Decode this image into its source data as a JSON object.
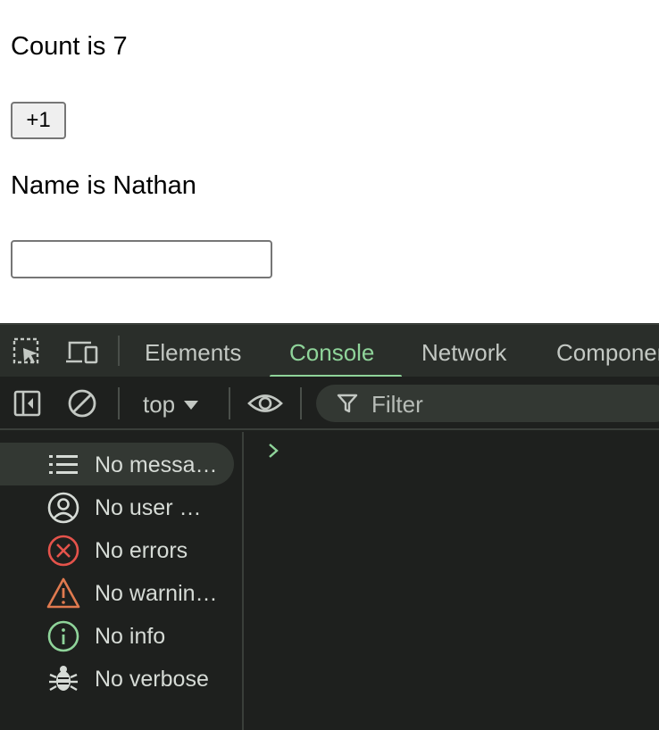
{
  "app": {
    "count_text": "Count is 7",
    "increment_label": "+1",
    "name_text": "Name is Nathan",
    "name_input_value": "",
    "name_input_placeholder": ""
  },
  "devtools": {
    "tabs": [
      {
        "label": "Elements",
        "active": false
      },
      {
        "label": "Console",
        "active": true
      },
      {
        "label": "Network",
        "active": false
      },
      {
        "label": "Components",
        "active": false
      }
    ],
    "icons": {
      "inspect": "inspect-element-icon",
      "device": "device-toolbar-icon",
      "sidebar_toggle": "sidebar-toggle-icon",
      "clear": "clear-console-icon",
      "eye": "live-expression-icon",
      "filter": "filter-icon",
      "prompt": "console-prompt-icon"
    },
    "context_select": "top",
    "filter_placeholder": "Filter",
    "sidebar_items": [
      {
        "label": "No messa…",
        "icon": "list-icon",
        "selected": true
      },
      {
        "label": "No user …",
        "icon": "user-icon",
        "selected": false
      },
      {
        "label": "No errors",
        "icon": "error-icon",
        "selected": false
      },
      {
        "label": "No warnin…",
        "icon": "warning-icon",
        "selected": false
      },
      {
        "label": "No info",
        "icon": "info-icon",
        "selected": false
      },
      {
        "label": "No verbose",
        "icon": "bug-icon",
        "selected": false
      }
    ],
    "colors": {
      "accent": "#8fd49a",
      "error": "#e5534b",
      "warning": "#e07a4f",
      "info": "#8fd49a",
      "background": "#1e201e",
      "tabbar": "#2a2e2a"
    }
  }
}
